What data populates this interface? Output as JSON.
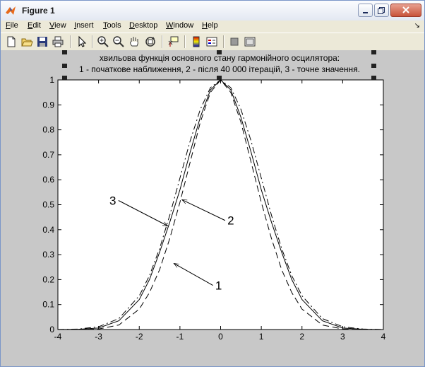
{
  "window": {
    "title": "Figure 1",
    "icon": "matlab-icon"
  },
  "menu": [
    {
      "label": "File",
      "u": "F",
      "rest": "ile"
    },
    {
      "label": "Edit",
      "u": "E",
      "rest": "dit"
    },
    {
      "label": "View",
      "u": "V",
      "rest": "iew"
    },
    {
      "label": "Insert",
      "u": "I",
      "rest": "nsert"
    },
    {
      "label": "Tools",
      "u": "T",
      "rest": "ools"
    },
    {
      "label": "Desktop",
      "u": "D",
      "rest": "esktop"
    },
    {
      "label": "Window",
      "u": "W",
      "rest": "indow"
    },
    {
      "label": "Help",
      "u": "H",
      "rest": "elp"
    }
  ],
  "toolbar": [
    "new-figure-icon",
    "open-file-icon",
    "save-icon",
    "print-icon",
    "edit-plot-icon",
    "zoom-in-icon",
    "zoom-out-icon",
    "pan-hand-icon",
    "rotate-3d-icon",
    "data-cursor-icon",
    "colorbar-icon",
    "legend-icon",
    "hide-plot-tools-icon",
    "show-plot-tools-icon"
  ],
  "chart_data": {
    "type": "line",
    "title_line1": "хвильова функція основного стану гармонійного осцилятора:",
    "title_line2": "1 - початкове наближення, 2 - після 40 000 ітерацій, 3 - точне значення.",
    "xlim": [
      -4,
      4
    ],
    "ylim": [
      0,
      1
    ],
    "xticks": [
      "-4",
      "-3",
      "-2",
      "-1",
      "0",
      "1",
      "2",
      "3",
      "4"
    ],
    "yticks": [
      "0",
      "0.1",
      "0.2",
      "0.3",
      "0.4",
      "0.5",
      "0.6",
      "0.7",
      "0.8",
      "0.9",
      "1"
    ],
    "series": [
      {
        "id": "1",
        "style": "dashed",
        "x": [
          -4,
          -3.5,
          -3,
          -2.5,
          -2,
          -1.75,
          -1.5,
          -1.25,
          -1,
          -0.75,
          -0.5,
          -0.25,
          0,
          0.25,
          0.5,
          0.75,
          1,
          1.25,
          1.5,
          1.75,
          2,
          2.5,
          3,
          3.5,
          4
        ],
        "y": [
          0,
          0,
          0.002,
          0.018,
          0.082,
          0.148,
          0.24,
          0.365,
          0.51,
          0.67,
          0.83,
          0.95,
          1,
          0.95,
          0.83,
          0.67,
          0.51,
          0.365,
          0.24,
          0.148,
          0.082,
          0.018,
          0.002,
          0,
          0
        ]
      },
      {
        "id": "2",
        "style": "solid",
        "x": [
          -4,
          -3.5,
          -3,
          -2.5,
          -2,
          -1.75,
          -1.5,
          -1.25,
          -1,
          -0.75,
          -0.5,
          -0.25,
          0,
          0.25,
          0.5,
          0.75,
          1,
          1.25,
          1.5,
          1.75,
          2,
          2.5,
          3,
          3.5,
          4
        ],
        "y": [
          0,
          0.001,
          0.006,
          0.035,
          0.12,
          0.2,
          0.31,
          0.43,
          0.56,
          0.71,
          0.85,
          0.96,
          1,
          0.96,
          0.85,
          0.71,
          0.56,
          0.43,
          0.31,
          0.2,
          0.12,
          0.035,
          0.006,
          0.001,
          0
        ]
      },
      {
        "id": "3",
        "style": "dashdot",
        "x": [
          -4,
          -3.5,
          -3,
          -2.5,
          -2,
          -1.75,
          -1.5,
          -1.25,
          -1,
          -0.75,
          -0.5,
          -0.25,
          0,
          0.25,
          0.5,
          0.75,
          1,
          1.25,
          1.5,
          1.75,
          2,
          2.5,
          3,
          3.5,
          4
        ],
        "y": [
          0.0003,
          0.002,
          0.011,
          0.044,
          0.135,
          0.216,
          0.325,
          0.458,
          0.607,
          0.755,
          0.882,
          0.969,
          1,
          0.969,
          0.882,
          0.755,
          0.607,
          0.458,
          0.325,
          0.216,
          0.135,
          0.044,
          0.011,
          0.002,
          0.0003
        ]
      }
    ],
    "annotations": [
      {
        "text": "3",
        "tx": -2.65,
        "ty": 0.5,
        "ax": -1.3,
        "ay": 0.415
      },
      {
        "text": "2",
        "tx": 0.25,
        "ty": 0.42,
        "ax": -0.95,
        "ay": 0.52
      },
      {
        "text": "1",
        "tx": -0.05,
        "ty": 0.16,
        "ax": -1.15,
        "ay": 0.265
      }
    ]
  }
}
